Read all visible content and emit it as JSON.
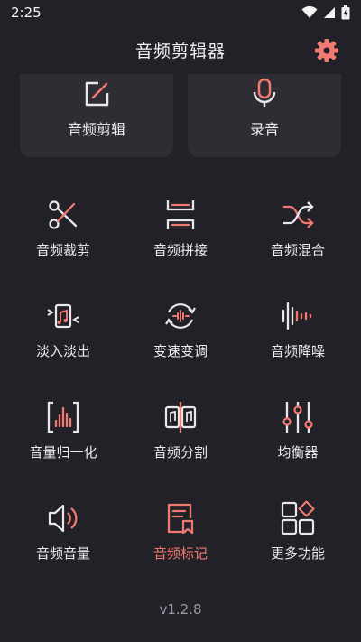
{
  "status": {
    "time": "2:25"
  },
  "header": {
    "title": "音频剪辑器"
  },
  "cards": [
    {
      "label": "音频剪辑",
      "icon": "edit-icon"
    },
    {
      "label": "录音",
      "icon": "microphone-icon"
    }
  ],
  "tools": [
    {
      "label": "音频裁剪",
      "icon": "scissors-icon"
    },
    {
      "label": "音频拼接",
      "icon": "merge-icon"
    },
    {
      "label": "音频混合",
      "icon": "shuffle-icon"
    },
    {
      "label": "淡入淡出",
      "icon": "fade-icon"
    },
    {
      "label": "变速变调",
      "icon": "speed-pitch-icon"
    },
    {
      "label": "音频降噪",
      "icon": "waveform-icon"
    },
    {
      "label": "音量归一化",
      "icon": "normalize-icon"
    },
    {
      "label": "音频分割",
      "icon": "split-icon"
    },
    {
      "label": "均衡器",
      "icon": "equalizer-icon"
    },
    {
      "label": "音频音量",
      "icon": "speaker-icon"
    },
    {
      "label": "音频标记",
      "icon": "marker-icon",
      "active": true
    },
    {
      "label": "更多功能",
      "icon": "more-icon"
    }
  ],
  "footer": {
    "version": "v1.2.8"
  },
  "colors": {
    "accent": "#f07a72",
    "icon_light": "#e8e8ec",
    "background": "#222127",
    "card": "#2e2d34"
  }
}
